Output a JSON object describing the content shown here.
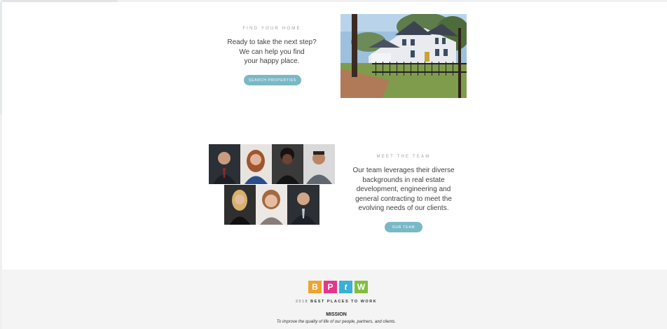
{
  "find_home": {
    "eyebrow": "FIND YOUR HOME",
    "lines": [
      "Ready to take the next step?",
      "We can help you find",
      "your happy place."
    ],
    "button": "SEARCH PROPERTIES"
  },
  "team": {
    "eyebrow": "MEET THE TEAM",
    "lines": [
      "Our team leverages their diverse",
      "backgrounds in real estate",
      "development, engineering and",
      "general contracting to meet the",
      "evolving needs of our clients."
    ],
    "button": "OUR TEAM"
  },
  "footer": {
    "logo_letters": [
      "B",
      "P",
      "t",
      "W"
    ],
    "logo_colors": [
      "#f0a32d",
      "#e2378a",
      "#3bb0d6",
      "#7fbf3f"
    ],
    "award_year": "2018",
    "award_text": "BEST PLACES TO WORK",
    "mission_title": "MISSION",
    "mission_text": "To improve the quality of life of our people, partners, and clients."
  }
}
